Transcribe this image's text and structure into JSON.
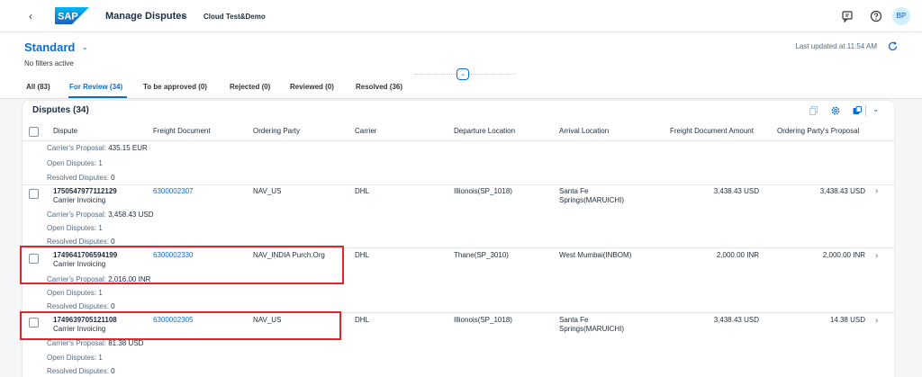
{
  "shell": {
    "back_icon": "chevron-left-icon",
    "logo_text": "SAP",
    "app_title": "Manage Disputes",
    "system": "Cloud Test&Demo",
    "avatar_initials": "BP"
  },
  "header": {
    "variant": "Standard",
    "filters": "No filters active",
    "last_updated": "Last updated at 11:54 AM",
    "tabs": [
      {
        "label": "All (83)"
      },
      {
        "label": "For Review (34)"
      },
      {
        "label": "To be approved (0)"
      },
      {
        "label": "Rejected (0)"
      },
      {
        "label": "Reviewed (0)"
      },
      {
        "label": "Resolved (36)"
      }
    ]
  },
  "table": {
    "title": "Disputes (34)",
    "columns": [
      "Dispute",
      "Freight Document",
      "Ordering Party",
      "Carrier",
      "Departure Location",
      "Arrival Location",
      "Freight Document Amount",
      "Ordering Party's Proposal"
    ],
    "sub_labels": {
      "carrier_proposal": "Carrier's Proposal:",
      "open_disputes": "Open Disputes:",
      "resolved_disputes": "Resolved Disputes:"
    },
    "partial_row": {
      "carrier_proposal": "435.15 EUR",
      "open_disputes": "1",
      "resolved_disputes": "0"
    },
    "rows": [
      {
        "dispute_id": "1750547977112129",
        "dispute_type": "Carrier Invoicing",
        "freight_document": "6300002307",
        "ordering_party": "NAV_US",
        "carrier": "DHL",
        "departure": "Illionois(SP_1018)",
        "arrival_line1": "Santa Fe",
        "arrival_line2": "Springs(MARUICHI)",
        "amount": "3,438.43 USD",
        "proposal": "3,438.43 USD",
        "carrier_proposal": "3,458.43 USD",
        "open_disputes": "1",
        "resolved_disputes": "0"
      },
      {
        "dispute_id": "1749641706594199",
        "dispute_type": "Carrier Invoicing",
        "freight_document": "6300002330",
        "ordering_party": "NAV_INDIA Purch.Org",
        "carrier": "DHL",
        "departure": "Thane(SP_3010)",
        "arrival_line1": "West Mumbai(INBOM)",
        "arrival_line2": "",
        "amount": "2,000.00 INR",
        "proposal": "2,000.00 INR",
        "carrier_proposal": "2,016.00 INR",
        "open_disputes": "1",
        "resolved_disputes": "0"
      },
      {
        "dispute_id": "1749639705121108",
        "dispute_type": "Carrier Invoicing",
        "freight_document": "6300002305",
        "ordering_party": "NAV_US",
        "carrier": "DHL",
        "departure": "Illionois(SP_1018)",
        "arrival_line1": "Santa Fe",
        "arrival_line2": "Springs(MARUICHI)",
        "amount": "3,438.43 USD",
        "proposal": "14.38 USD",
        "carrier_proposal": "81.38 USD",
        "open_disputes": "1",
        "resolved_disputes": "0"
      }
    ]
  },
  "colors": {
    "accent": "#0a6ed1",
    "highlight": "#e3242b"
  }
}
